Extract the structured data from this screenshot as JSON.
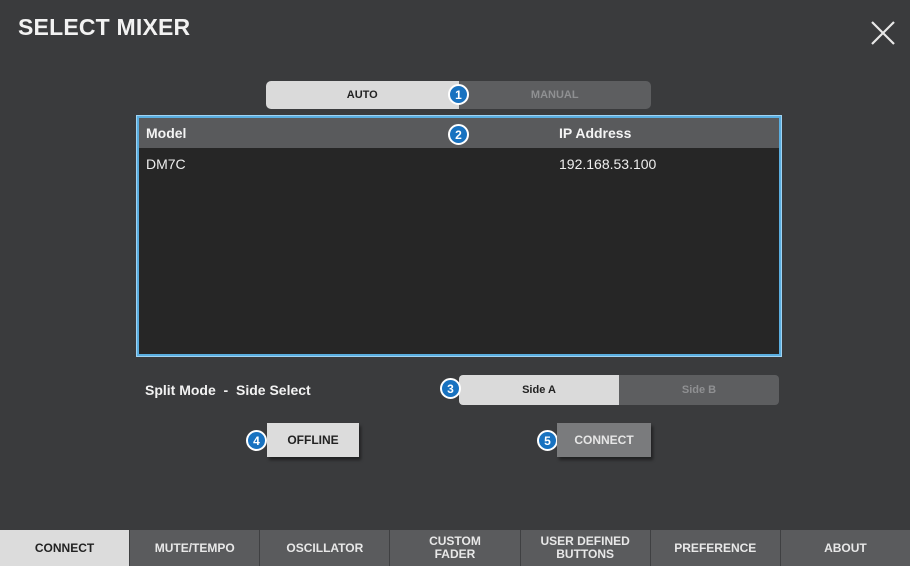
{
  "window": {
    "title": "SELECT MIXER",
    "close_icon": "close-icon"
  },
  "mode_toggle": {
    "options": [
      "AUTO",
      "MANUAL"
    ],
    "selected": "AUTO"
  },
  "badges": [
    "1",
    "2",
    "3",
    "4",
    "5"
  ],
  "mixer_table": {
    "columns": [
      "Model",
      "IP Address"
    ],
    "rows": [
      {
        "model": "DM7C",
        "ip": "192.168.53.100"
      }
    ]
  },
  "split_mode": {
    "label": "Split Mode  -  Side Select",
    "options": [
      "Side A",
      "Side B"
    ],
    "selected": "Side A"
  },
  "actions": {
    "offline_label": "OFFLINE",
    "connect_label": "CONNECT"
  },
  "tabs": [
    {
      "label": "CONNECT",
      "active": true
    },
    {
      "label": "MUTE/TEMPO",
      "active": false
    },
    {
      "label": "OSCILLATOR",
      "active": false
    },
    {
      "label": "CUSTOM\nFADER",
      "active": false
    },
    {
      "label": "USER DEFINED\nBUTTONS",
      "active": false
    },
    {
      "label": "PREFERENCE",
      "active": false
    },
    {
      "label": "ABOUT",
      "active": false
    }
  ],
  "colors": {
    "background": "#3a3b3d",
    "accent_blue": "#1872c0",
    "table_border": "#5aaee0",
    "active_segment": "#dadada",
    "inactive_segment": "#5d5e60"
  }
}
